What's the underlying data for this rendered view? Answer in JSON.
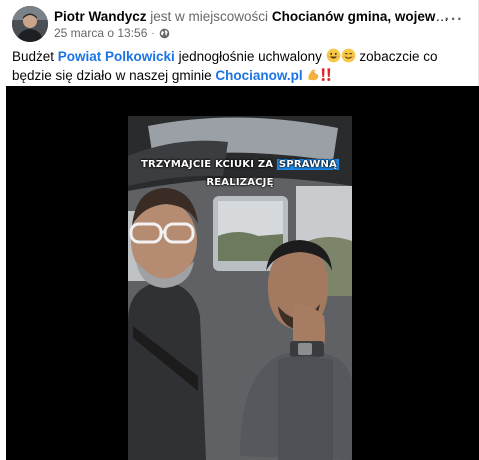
{
  "post": {
    "author": "Piotr Wandycz",
    "connector": "jest w miejscowości",
    "location": "Chocianów gmina, województwo ...",
    "timestamp": "25 marca o 13:56",
    "separator": "·",
    "more_icon": "more-options-icon",
    "privacy_icon": "globe-icon",
    "text_parts": {
      "p1": "Budżet ",
      "link1": "Powiat Polkowicki",
      "p2": " jednogłośnie uchwalony ",
      "p3": " zobaczcie co będzie się działo w naszej gminie ",
      "link2": "Chocianow.pl",
      "p4": " "
    },
    "emoji_names": [
      "grinning-face-emoji",
      "grinning-face-emoji",
      "flexed-biceps-emoji",
      "double-exclamation-emoji"
    ]
  },
  "video": {
    "caption_line1_a": "TRZYMAJCIE KCIUKI ZA ",
    "caption_line1_b": "SPRAWNĄ",
    "caption_line2": "REALIZACJĘ"
  },
  "colors": {
    "link": "#1b74e4",
    "secondary_text": "#65676b",
    "caption_highlight": "#1e88e5",
    "media_background": "#000000"
  }
}
